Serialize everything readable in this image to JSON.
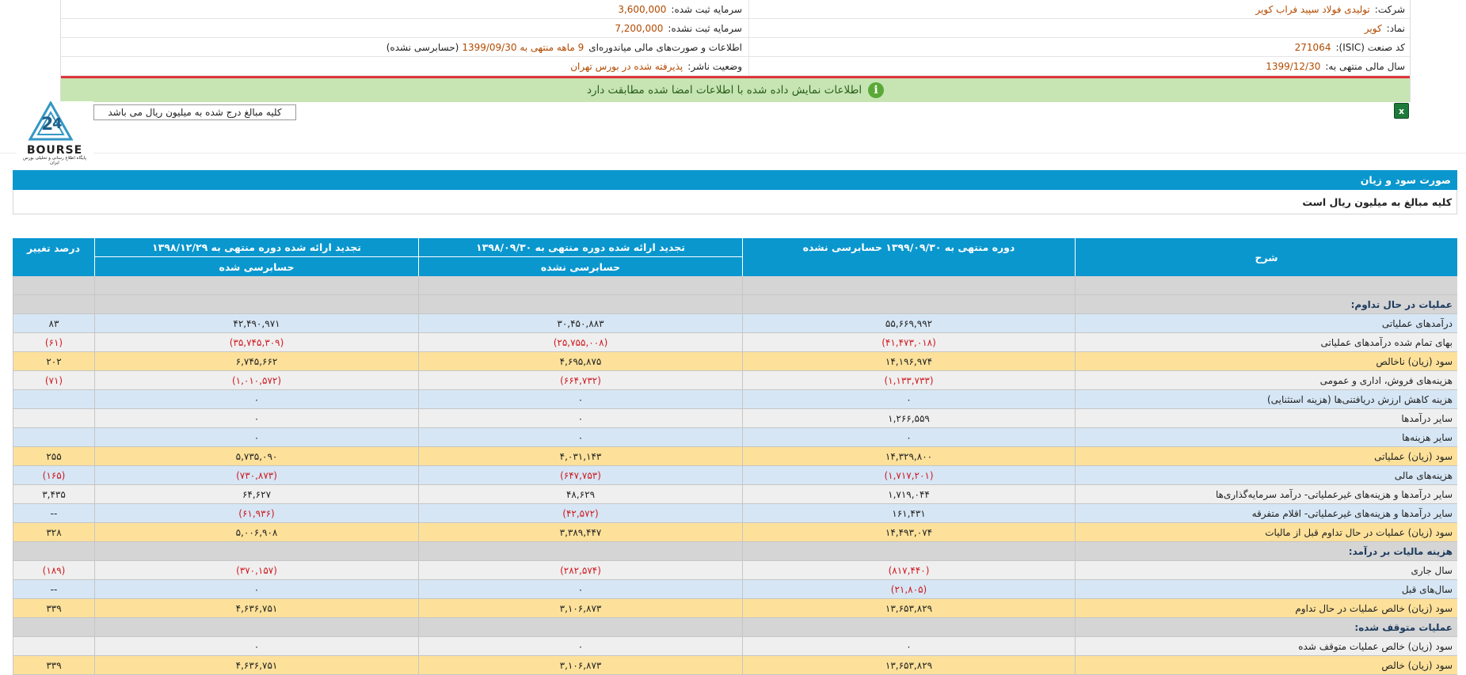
{
  "company_info": {
    "rows": [
      {
        "label": "شرکت:",
        "value": "تولیدی فولاد سپید فراب کویر",
        "left_label": "سرمایه ثبت شده:",
        "left_value": "3,600,000",
        "left_note": ""
      },
      {
        "label": "نماد:",
        "value": "کویر",
        "left_label": "سرمایه ثبت نشده:",
        "left_value": "7,200,000",
        "left_note": ""
      },
      {
        "label": "کد صنعت (ISIC):",
        "value": "271064",
        "left_label": "اطلاعات و صورت‌های مالی میاندوره‌ای",
        "left_value": "9 ماهه منتهی به 1399/09/30",
        "left_note": "(حسابرسی نشده)"
      },
      {
        "label": "سال مالی منتهی به:",
        "value": "1399/12/30",
        "left_label": "وضعیت ناشر:",
        "left_value": "پذیرفته شده در بورس تهران",
        "left_note": ""
      }
    ],
    "notice": "اطلاعات نمایش داده شده با اطلاعات امضا شده مطابقت دارد",
    "notice_icon": "info-icon",
    "units_note": "کلیه مبالغ درج شده به میلیون ریال می باشد",
    "excel_icon": "excel-icon",
    "logo_text": "BOURSE",
    "logo_subtext": "پایگاه اطلاع رسانی و تحلیلی بورس ایران"
  },
  "statement": {
    "title": "صورت سود و زیان",
    "subtitle": "کلیه مبالغ به میلیون ریال است",
    "columns": {
      "desc": "شرح",
      "period1": "دوره منتهی به ۱۳۹۹/۰۹/۳۰ حسابرسی نشده",
      "period2": "تجدید ارائه شده دوره منتهی به ۱۳۹۸/۰۹/۳۰",
      "period2_sub": "حسابرسی نشده",
      "period3": "تجدید ارائه شده دوره منتهی به ۱۳۹۸/۱۲/۲۹",
      "period3_sub": "حسابرسی شده",
      "pct": "درصد تغییر"
    },
    "rows": [
      {
        "type": "section",
        "desc": "",
        "v1": "",
        "v2": "",
        "v3": "",
        "pct": ""
      },
      {
        "type": "section",
        "desc": "عملیات در حال تداوم:",
        "v1": "",
        "v2": "",
        "v3": "",
        "pct": ""
      },
      {
        "type": "blue",
        "desc": "درآمدهای عملیاتی",
        "v1": "۵۵,۶۶۹,۹۹۲",
        "v2": "۳۰,۴۵۰,۸۸۳",
        "v3": "۴۲,۴۹۰,۹۷۱",
        "pct": "۸۳"
      },
      {
        "type": "grey",
        "desc": "بهای تمام شده درآمدهای عملیاتی",
        "v1": "(۴۱,۴۷۳,۰۱۸)",
        "v2": "(۲۵,۷۵۵,۰۰۸)",
        "v3": "(۳۵,۷۴۵,۳۰۹)",
        "pct": "(۶۱)"
      },
      {
        "type": "yellow",
        "desc": "سود (زیان) ناخالص",
        "v1": "۱۴,۱۹۶,۹۷۴",
        "v2": "۴,۶۹۵,۸۷۵",
        "v3": "۶,۷۴۵,۶۶۲",
        "pct": "۲۰۲"
      },
      {
        "type": "grey",
        "desc": "هزینه‌های فروش، اداری و عمومی",
        "v1": "(۱,۱۳۳,۷۳۳)",
        "v2": "(۶۶۴,۷۳۲)",
        "v3": "(۱,۰۱۰,۵۷۲)",
        "pct": "(۷۱)"
      },
      {
        "type": "blue",
        "desc": "هزینه کاهش ارزش دریافتنی‌ها (هزینه استثنایی)",
        "v1": "۰",
        "v2": "۰",
        "v3": "۰",
        "pct": ""
      },
      {
        "type": "grey",
        "desc": "سایر درآمدها",
        "v1": "۱,۲۶۶,۵۵۹",
        "v2": "۰",
        "v3": "۰",
        "pct": ""
      },
      {
        "type": "blue",
        "desc": "سایر هزینه‌ها",
        "v1": "۰",
        "v2": "۰",
        "v3": "۰",
        "pct": ""
      },
      {
        "type": "yellow",
        "desc": "سود (زیان) عملیاتی",
        "v1": "۱۴,۳۲۹,۸۰۰",
        "v2": "۴,۰۳۱,۱۴۳",
        "v3": "۵,۷۳۵,۰۹۰",
        "pct": "۲۵۵"
      },
      {
        "type": "blue",
        "desc": "هزینه‌های مالی",
        "v1": "(۱,۷۱۷,۲۰۱)",
        "v2": "(۶۴۷,۷۵۳)",
        "v3": "(۷۳۰,۸۷۳)",
        "pct": "(۱۶۵)"
      },
      {
        "type": "grey",
        "desc": "سایر درآمدها و هزینه‌های غیرعملیاتی- درآمد سرمایه‌گذاری‌ها",
        "v1": "۱,۷۱۹,۰۴۴",
        "v2": "۴۸,۶۲۹",
        "v3": "۶۴,۶۲۷",
        "pct": "۳,۴۳۵"
      },
      {
        "type": "blue",
        "desc": "سایر درآمدها و هزینه‌های غیرعملیاتی- اقلام متفرقه",
        "v1": "۱۶۱,۴۳۱",
        "v2": "(۴۲,۵۷۲)",
        "v3": "(۶۱,۹۳۶)",
        "pct": "--"
      },
      {
        "type": "yellow",
        "desc": "سود (زیان) عملیات در حال تداوم قبل از مالیات",
        "v1": "۱۴,۴۹۳,۰۷۴",
        "v2": "۳,۳۸۹,۴۴۷",
        "v3": "۵,۰۰۶,۹۰۸",
        "pct": "۳۲۸"
      },
      {
        "type": "section",
        "desc": "هزینه مالیات بر درآمد:",
        "v1": "",
        "v2": "",
        "v3": "",
        "pct": ""
      },
      {
        "type": "grey",
        "desc": "سال جاری",
        "v1": "(۸۱۷,۴۴۰)",
        "v2": "(۲۸۲,۵۷۴)",
        "v3": "(۳۷۰,۱۵۷)",
        "pct": "(۱۸۹)"
      },
      {
        "type": "blue",
        "desc": "سال‌های قبل",
        "v1": "(۲۱,۸۰۵)",
        "v2": "۰",
        "v3": "۰",
        "pct": "--"
      },
      {
        "type": "yellow",
        "desc": "سود (زیان) خالص عملیات در حال تداوم",
        "v1": "۱۳,۶۵۳,۸۲۹",
        "v2": "۳,۱۰۶,۸۷۳",
        "v3": "۴,۶۳۶,۷۵۱",
        "pct": "۳۳۹"
      },
      {
        "type": "section",
        "desc": "عملیات متوقف شده:",
        "v1": "",
        "v2": "",
        "v3": "",
        "pct": ""
      },
      {
        "type": "grey",
        "desc": "سود (زیان) خالص عملیات متوقف شده",
        "v1": "۰",
        "v2": "۰",
        "v3": "۰",
        "pct": ""
      },
      {
        "type": "yellow",
        "desc": "سود (زیان) خالص",
        "v1": "۱۳,۶۵۳,۸۲۹",
        "v2": "۳,۱۰۶,۸۷۳",
        "v3": "۴,۶۳۶,۷۵۱",
        "pct": "۳۳۹"
      }
    ]
  }
}
